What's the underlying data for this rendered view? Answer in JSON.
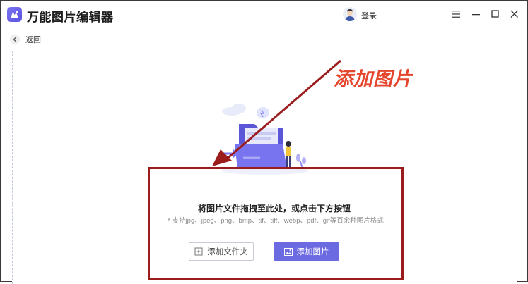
{
  "titlebar": {
    "app_title": "万能图片编辑器",
    "login_label": "登录"
  },
  "nav": {
    "back_label": "返回"
  },
  "annotation": {
    "label": "添加图片",
    "color": "#e5472e",
    "box_color": "#9b1c1c"
  },
  "dropzone": {
    "main_hint": "将图片文件拖拽至此处，或点击下方按钮",
    "sub_hint": "* 支持jpg、jpeg、png、bmp、tif、tiff、webp、pdf、gif等百余种图片格式"
  },
  "buttons": {
    "add_folder": "添加文件夹",
    "add_image": "添加图片"
  },
  "colors": {
    "accent": "#6c6ae0"
  }
}
